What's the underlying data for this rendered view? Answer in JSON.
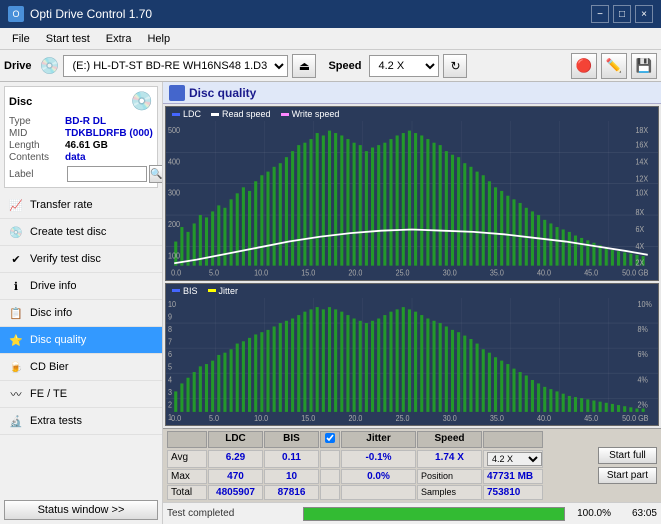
{
  "titlebar": {
    "title": "Opti Drive Control 1.70",
    "icon": "O",
    "minimize_label": "−",
    "maximize_label": "□",
    "close_label": "×"
  },
  "menubar": {
    "items": [
      "File",
      "Start test",
      "Extra",
      "Help"
    ]
  },
  "drive_toolbar": {
    "drive_label": "Drive",
    "drive_value": "(E:)  HL-DT-ST BD-RE  WH16NS48 1.D3",
    "speed_label": "Speed",
    "speed_value": "4.2 X"
  },
  "disc_panel": {
    "title": "Disc",
    "type_label": "Type",
    "type_value": "BD-R DL",
    "mid_label": "MID",
    "mid_value": "TDKBLDRFB (000)",
    "length_label": "Length",
    "length_value": "46.61 GB",
    "contents_label": "Contents",
    "contents_value": "data",
    "label_label": "Label"
  },
  "sidebar_items": [
    {
      "id": "transfer-rate",
      "label": "Transfer rate",
      "icon": "chart"
    },
    {
      "id": "create-test-disc",
      "label": "Create test disc",
      "icon": "disc"
    },
    {
      "id": "verify-test-disc",
      "label": "Verify test disc",
      "icon": "check"
    },
    {
      "id": "drive-info",
      "label": "Drive info",
      "icon": "info"
    },
    {
      "id": "disc-info",
      "label": "Disc info",
      "icon": "disc2"
    },
    {
      "id": "disc-quality",
      "label": "Disc quality",
      "icon": "quality",
      "active": true
    },
    {
      "id": "cd-bier",
      "label": "CD Bier",
      "icon": "cd"
    },
    {
      "id": "fe-te",
      "label": "FE / TE",
      "icon": "fe"
    },
    {
      "id": "extra-tests",
      "label": "Extra tests",
      "icon": "extra"
    }
  ],
  "status_window_btn": "Status window >>",
  "disc_quality": {
    "title": "Disc quality",
    "legend": {
      "ldc_label": "LDC",
      "read_speed_label": "Read speed",
      "write_speed_label": "Write speed",
      "bis_label": "BIS",
      "jitter_label": "Jitter"
    }
  },
  "stats": {
    "headers": [
      "",
      "LDC",
      "BIS",
      "",
      "Jitter",
      "Speed",
      ""
    ],
    "avg_label": "Avg",
    "max_label": "Max",
    "total_label": "Total",
    "avg_ldc": "6.29",
    "avg_bis": "0.11",
    "avg_jitter": "-0.1%",
    "max_ldc": "470",
    "max_bis": "10",
    "max_jitter": "0.0%",
    "total_ldc": "4805907",
    "total_bis": "87816",
    "jitter_checked": true,
    "speed_label": "Speed",
    "speed_value": "1.74 X",
    "speed_dropdown": "4.2 X",
    "position_label": "Position",
    "position_value": "47731 MB",
    "samples_label": "Samples",
    "samples_value": "753810",
    "start_full_label": "Start full",
    "start_part_label": "Start part"
  },
  "statusbar": {
    "status_text": "Test completed",
    "progress": 100,
    "progress_label": "100.0%",
    "time_label": "63:05"
  },
  "chart1": {
    "y_labels_left": [
      "500",
      "400",
      "300",
      "200",
      "100",
      "0"
    ],
    "y_labels_right": [
      "18X",
      "16X",
      "14X",
      "12X",
      "10X",
      "8X",
      "6X",
      "4X",
      "2X"
    ],
    "x_labels": [
      "0.0",
      "5.0",
      "10.0",
      "15.0",
      "20.0",
      "25.0",
      "30.0",
      "35.0",
      "40.0",
      "45.0",
      "50.0 GB"
    ]
  },
  "chart2": {
    "y_labels_left": [
      "10",
      "9",
      "8",
      "7",
      "6",
      "5",
      "4",
      "3",
      "2",
      "1"
    ],
    "y_labels_right": [
      "10%",
      "8%",
      "6%",
      "4%",
      "2%"
    ],
    "x_labels": [
      "0.0",
      "5.0",
      "10.0",
      "15.0",
      "20.0",
      "25.0",
      "30.0",
      "35.0",
      "40.0",
      "45.0",
      "50.0 GB"
    ]
  },
  "colors": {
    "ldc": "#4466ff",
    "read_speed": "#ffffff",
    "write_speed": "#ff44ff",
    "bis": "#44ff44",
    "jitter": "#ffff00",
    "chart_bg": "#2a3a5a",
    "bar_green": "#22cc22",
    "bar_blue": "#4466ff",
    "active_sidebar": "#3399ff"
  }
}
